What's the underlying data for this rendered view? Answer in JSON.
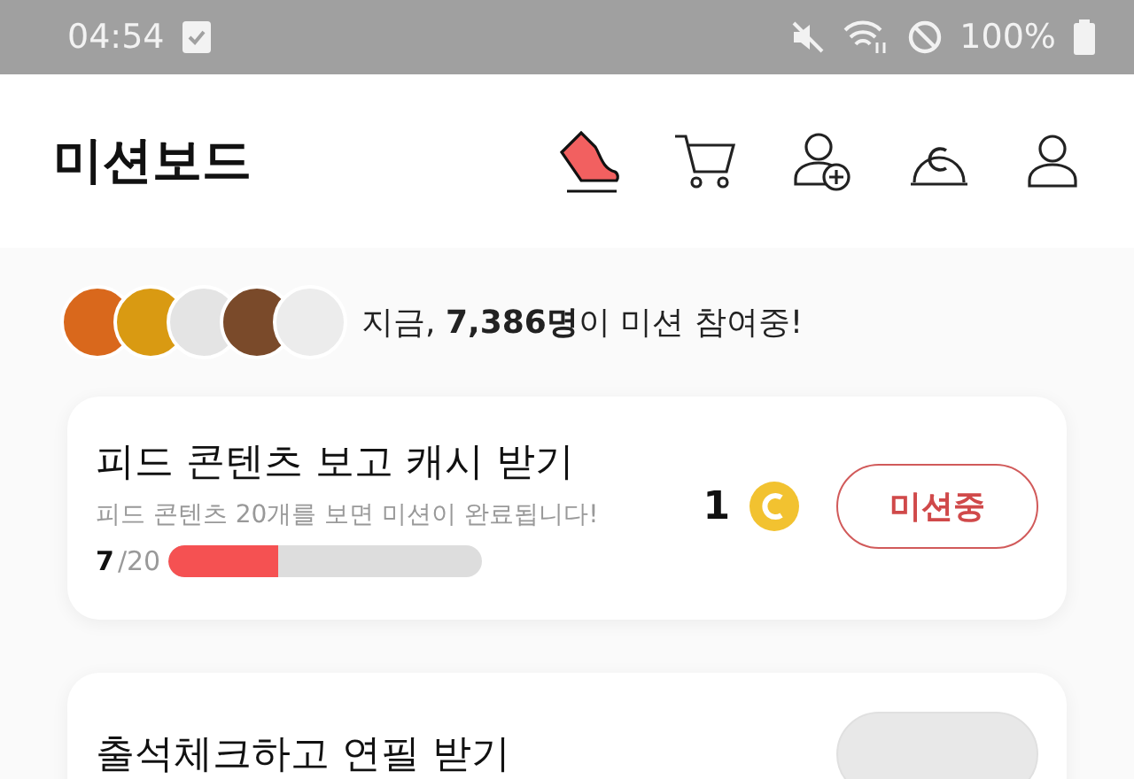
{
  "status_bar": {
    "time": "04:54",
    "battery": "100%"
  },
  "header": {
    "title": "미션보드"
  },
  "participants": {
    "text": "지금, **7,386명**이 미션 참여중!"
  },
  "missions": [
    {
      "title": "피드 콘텐츠 보고 캐시 받기",
      "description": "피드 콘텐츠 20개를 보면 미션이 완료됩니다!",
      "progress_done": "7",
      "progress_total": "/20",
      "level": 0.35,
      "reward": "1",
      "button": "미션중",
      "active": true
    },
    {
      "title": "출석체크하고 연필 받기",
      "active": false
    }
  ]
}
